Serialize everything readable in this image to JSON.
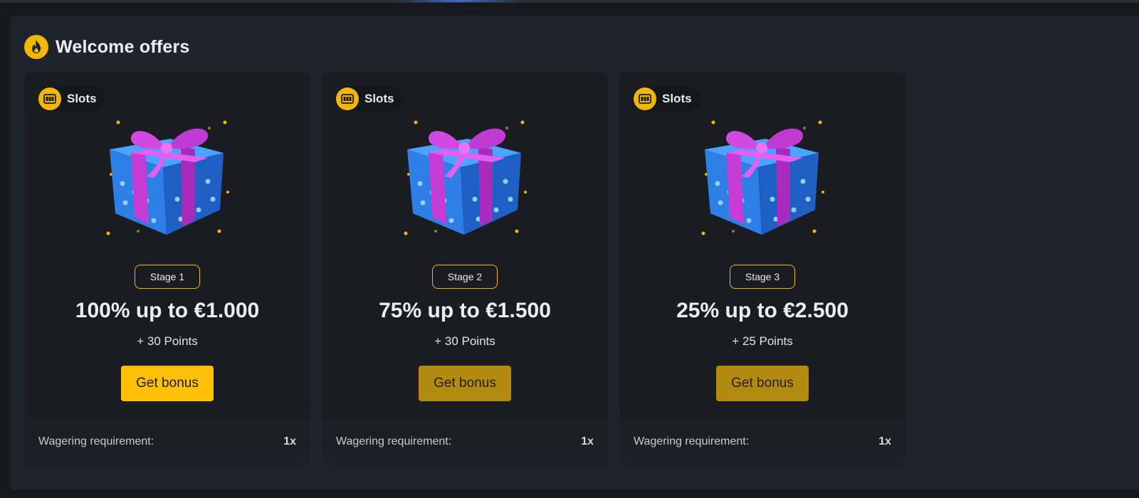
{
  "header": {
    "title": "Welcome offers",
    "icon": "flame-icon"
  },
  "colors": {
    "accent": "#ffc107",
    "accent_dim": "#b38a10",
    "background": "#1f232b",
    "card": "#1a1c21"
  },
  "cards": [
    {
      "tag": "Slots",
      "tag_icon": "slot-machine-icon",
      "image": "gift-box-icon",
      "stage": "Stage 1",
      "title": "100% up to €1.000",
      "points": "+ 30 Points",
      "button": "Get bonus",
      "button_active": true,
      "wager_label": "Wagering requirement:",
      "wager_value": "1x"
    },
    {
      "tag": "Slots",
      "tag_icon": "slot-machine-icon",
      "image": "gift-box-icon",
      "stage": "Stage 2",
      "title": "75% up to €1.500",
      "points": "+ 30 Points",
      "button": "Get bonus",
      "button_active": false,
      "wager_label": "Wagering requirement:",
      "wager_value": "1x"
    },
    {
      "tag": "Slots",
      "tag_icon": "slot-machine-icon",
      "image": "gift-box-icon",
      "stage": "Stage 3",
      "title": "25% up to €2.500",
      "points": "+ 25 Points",
      "button": "Get bonus",
      "button_active": false,
      "wager_label": "Wagering requirement:",
      "wager_value": "1x"
    }
  ]
}
